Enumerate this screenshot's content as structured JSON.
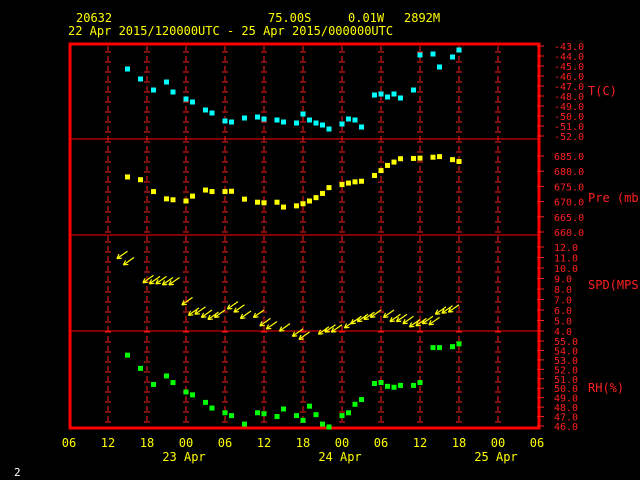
{
  "header": {
    "station": "20632",
    "lat": "75.00S",
    "lon": "0.01W",
    "elev": "2892M",
    "period": "22 Apr 2015/120000UTC - 25 Apr 2015/000000UTC"
  },
  "page_number": "2",
  "colors": {
    "frame": "#ff0000",
    "axis": "#ff2020",
    "temperature": "#00ffff",
    "pressure": "#ffff00",
    "wind": "#ffff00",
    "humidity": "#00ff00",
    "text": "#ffff00"
  },
  "chart_data": {
    "type": "scatter",
    "x_ticks": [
      "06",
      "12",
      "18",
      "00",
      "06",
      "12",
      "18",
      "00",
      "06",
      "12",
      "18",
      "00",
      "06"
    ],
    "day_labels": [
      "23 Apr",
      "24 Apr",
      "25 Apr"
    ],
    "xlim_hours": [
      -6,
      66
    ],
    "panels": [
      {
        "key": "temperature",
        "label": "T(C)",
        "ylim": [
          -52,
          -43
        ],
        "ticks": [
          "-43.0",
          "-44.0",
          "-45.0",
          "-46.0",
          "-47.0",
          "-48.0",
          "-49.0",
          "-50.0",
          "-51.0",
          "-52.0"
        ],
        "x": [
          3,
          5,
          7,
          9,
          10,
          12,
          13,
          15,
          16,
          18,
          19,
          21,
          23,
          24,
          26,
          27,
          29,
          30,
          31,
          32,
          33,
          34,
          36,
          37,
          38,
          39,
          41,
          42,
          43,
          44,
          45,
          47,
          48,
          50,
          51,
          53,
          54
        ],
        "y": [
          -45.3,
          -46.3,
          -47.4,
          -46.6,
          -47.6,
          -48.3,
          -48.6,
          -49.4,
          -49.7,
          -50.5,
          -50.6,
          -50.2,
          -50.1,
          -50.3,
          -50.4,
          -50.6,
          -50.7,
          -49.8,
          -50.4,
          -50.7,
          -50.9,
          -51.3,
          -50.8,
          -50.3,
          -50.4,
          -51.1,
          -47.9,
          -47.8,
          -48.1,
          -47.8,
          -48.2,
          -47.4,
          -43.9,
          -43.8,
          -45.1,
          -44.1,
          -43.4
        ]
      },
      {
        "key": "pressure",
        "label": "Pre (mb)",
        "ylim": [
          660,
          685
        ],
        "ticks": [
          "685.0",
          "680.0",
          "675.0",
          "670.0",
          "665.0",
          "660.0"
        ],
        "x": [
          3,
          5,
          7,
          9,
          10,
          12,
          13,
          15,
          16,
          18,
          19,
          21,
          23,
          24,
          26,
          27,
          29,
          30,
          31,
          32,
          33,
          34,
          36,
          37,
          38,
          39,
          41,
          42,
          43,
          44,
          45,
          47,
          48,
          50,
          51,
          53,
          54
        ],
        "y": [
          678.1,
          677.2,
          673.3,
          670.9,
          670.6,
          670.2,
          671.8,
          673.8,
          673.3,
          673.3,
          673.4,
          670.8,
          669.8,
          669.6,
          669.8,
          668.2,
          668.6,
          669.3,
          670.2,
          671.3,
          672.7,
          674.6,
          675.6,
          676.1,
          676.5,
          676.7,
          678.6,
          680.2,
          681.9,
          683.0,
          684.1,
          684.2,
          684.3,
          684.6,
          684.8,
          683.8,
          683.2
        ]
      },
      {
        "key": "wind",
        "label": "SPD(MPS)",
        "ylim": [
          4,
          12
        ],
        "ticks": [
          "12.0",
          "11.0",
          "10.0",
          "9.0",
          "8.0",
          "7.0",
          "6.0",
          "5.0",
          "4.0"
        ],
        "x": [
          3,
          4,
          7,
          8,
          9,
          10,
          11,
          13,
          14,
          15,
          16,
          17,
          18,
          20,
          21,
          22,
          24,
          25,
          26,
          28,
          30,
          31,
          34,
          35,
          36,
          38,
          39,
          40,
          41,
          42,
          44,
          45,
          46,
          47,
          48,
          49,
          50,
          51,
          52,
          53,
          54
        ],
        "y": [
          11.6,
          11.0,
          9.3,
          9.2,
          9.2,
          9.1,
          9.1,
          7.2,
          6.2,
          6.3,
          6.0,
          5.8,
          6.0,
          6.8,
          6.5,
          5.9,
          6.0,
          5.2,
          4.9,
          4.7,
          4.2,
          3.9,
          4.4,
          4.6,
          4.6,
          5.0,
          5.4,
          5.6,
          5.8,
          6.0,
          6.0,
          5.6,
          5.6,
          5.4,
          5.1,
          5.2,
          5.4,
          5.3,
          6.3,
          6.4,
          6.5
        ]
      },
      {
        "key": "humidity",
        "label": "RH(%)",
        "ylim": [
          46,
          55
        ],
        "ticks": [
          "55.0",
          "54.0",
          "53.0",
          "52.0",
          "51.0",
          "50.0",
          "49.0",
          "48.0",
          "47.0",
          "46.0"
        ],
        "x": [
          3,
          5,
          7,
          9,
          10,
          12,
          13,
          15,
          16,
          18,
          19,
          21,
          23,
          24,
          26,
          27,
          29,
          30,
          31,
          32,
          33,
          34,
          36,
          37,
          38,
          39,
          41,
          42,
          43,
          44,
          45,
          47,
          48,
          50,
          51,
          53,
          54
        ],
        "y": [
          53.5,
          52.1,
          50.4,
          51.3,
          50.6,
          49.6,
          49.3,
          48.5,
          47.9,
          47.4,
          47.1,
          46.2,
          47.4,
          47.3,
          47.0,
          47.8,
          47.1,
          46.6,
          48.1,
          47.2,
          46.2,
          45.9,
          47.1,
          47.4,
          48.3,
          48.8,
          50.5,
          50.6,
          50.2,
          50.1,
          50.3,
          50.3,
          50.6,
          54.3,
          54.3,
          54.4,
          54.7
        ]
      }
    ]
  }
}
